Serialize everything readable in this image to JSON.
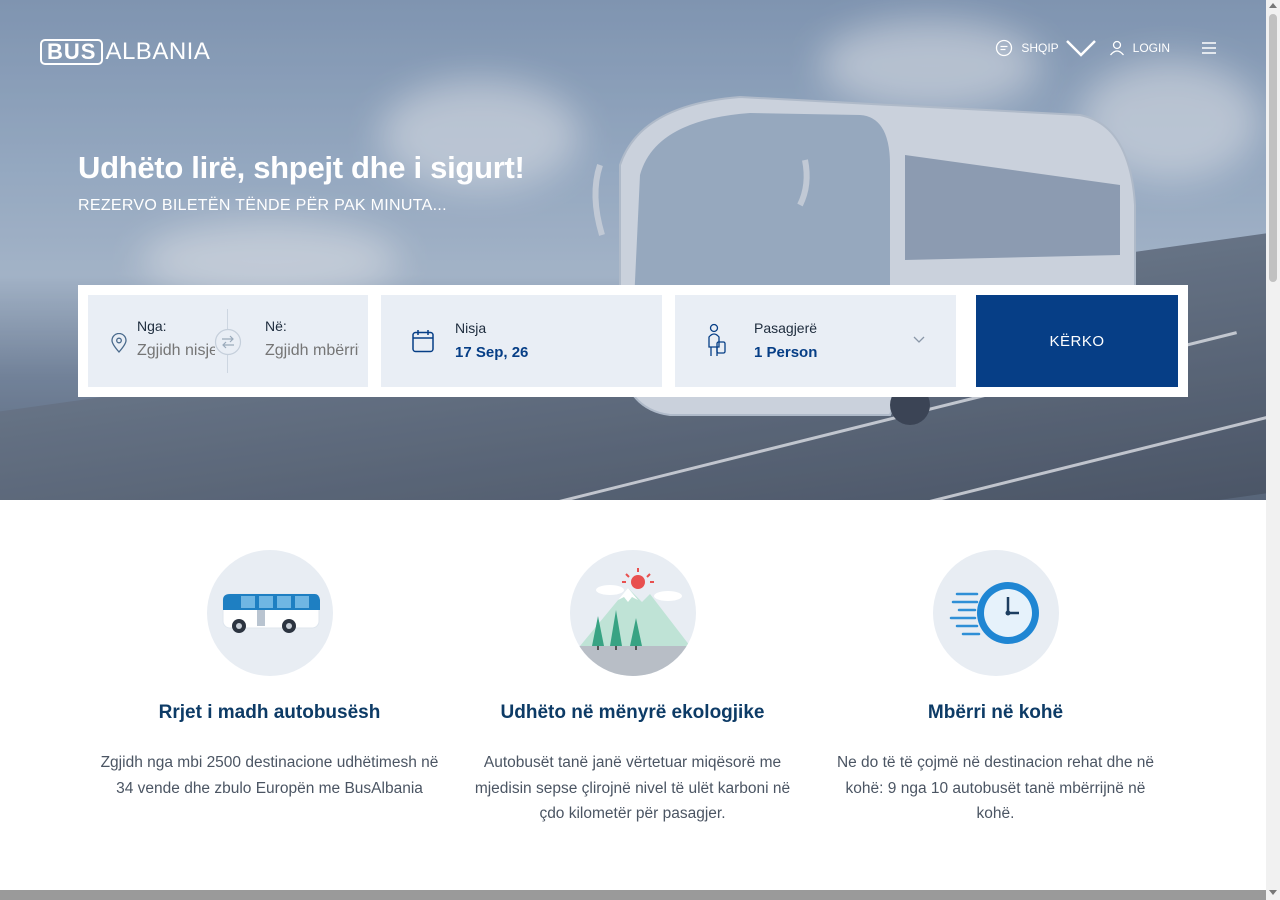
{
  "brand": {
    "logo_box": "BUS",
    "logo_text": "ALBANIA"
  },
  "nav": {
    "language": "SHQIP",
    "login": "LOGIN",
    "icons": [
      "chat-icon",
      "chevron-down-icon",
      "user-icon",
      "hamburger-menu-icon"
    ]
  },
  "hero": {
    "title": "Udhëto lirë, shpejt dhe i sigurt!",
    "subtitle": "REZERVO BILETËN TËNDE PËR PAK MINUTA..."
  },
  "search": {
    "from_label": "Nga:",
    "from_placeholder": "Zgjidh nisjen",
    "to_label": "Në:",
    "to_placeholder": "Zgjidh mbërritjen",
    "date_label": "Nisja",
    "date_value": "17 Sep, 26",
    "passengers_label": "Pasagjerë",
    "passengers_value": "1 Person",
    "button": "KËRKO",
    "accent_color": "#063e86"
  },
  "features": [
    {
      "icon": "bus-icon",
      "title": "Rrjet i madh autobusësh",
      "text": "Zgjidh nga mbi 2500 destinacione udhëtimesh në 34 vende dhe zbulo Europën me BusAlbania"
    },
    {
      "icon": "mountain-eco-icon",
      "title": "Udhëto në mënyrë ekologjike",
      "text": "Autobusët tanë janë vërtetuar miqësorë me mjedisin sepse çlirojnë nivel të ulët karboni në çdo kilometër për pasagjer."
    },
    {
      "icon": "fast-clock-icon",
      "title": "Mbërri në kohë",
      "text": "Ne do të të çojmë në destinacion rehat dhe në kohë: 9 nga 10 autobusët tanë mbërrijnë në kohë."
    }
  ]
}
